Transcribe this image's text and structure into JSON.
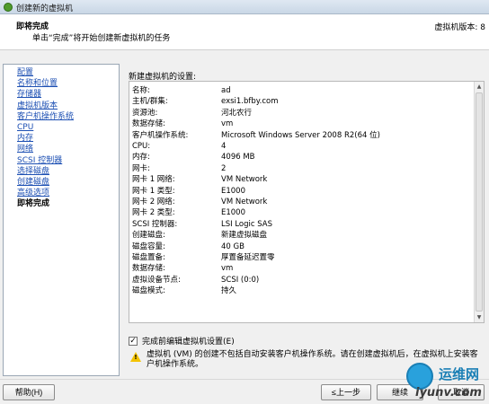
{
  "window": {
    "title": "创建新的虚拟机"
  },
  "header": {
    "title": "即将完成",
    "subtitle": "单击“完成”将开始创建新虚拟机的任务",
    "version": "虚拟机版本: 8"
  },
  "nav": {
    "items": [
      {
        "label": "配置"
      },
      {
        "label": "名称和位置"
      },
      {
        "label": "存储器"
      },
      {
        "label": "虚拟机版本"
      },
      {
        "label": "客户机操作系统"
      },
      {
        "label": "CPU"
      },
      {
        "label": "内存"
      },
      {
        "label": "网络"
      },
      {
        "label": "SCSI 控制器"
      },
      {
        "label": "选择磁盘"
      },
      {
        "label": "创建磁盘"
      },
      {
        "label": "高级选项"
      },
      {
        "label": "即将完成",
        "active": true
      }
    ]
  },
  "summary": {
    "label": "新建虚拟机的设置:",
    "rows": [
      {
        "key": "名称:",
        "value": "ad"
      },
      {
        "key": "主机/群集:",
        "value": "exsi1.bfby.com"
      },
      {
        "key": "资源池:",
        "value": "河北农行"
      },
      {
        "key": "数据存储:",
        "value": "vm"
      },
      {
        "key": "客户机操作系统:",
        "value": "Microsoft Windows Server 2008 R2(64 位)"
      },
      {
        "key": "CPU:",
        "value": "4"
      },
      {
        "key": "内存:",
        "value": "4096 MB"
      },
      {
        "key": "网卡:",
        "value": "2"
      },
      {
        "key": "网卡 1 网络:",
        "value": "VM Network"
      },
      {
        "key": "网卡 1 类型:",
        "value": "E1000"
      },
      {
        "key": "网卡 2 网络:",
        "value": "VM Network"
      },
      {
        "key": "网卡 2 类型:",
        "value": "E1000"
      },
      {
        "key": "SCSI 控制器:",
        "value": "LSI Logic SAS"
      },
      {
        "key": "创建磁盘:",
        "value": "新建虚拟磁盘"
      },
      {
        "key": "磁盘容量:",
        "value": "40 GB"
      },
      {
        "key": "磁盘置备:",
        "value": "厚置备延迟置零"
      },
      {
        "key": "数据存储:",
        "value": "vm"
      },
      {
        "key": "虚拟设备节点:",
        "value": "SCSI (0:0)"
      },
      {
        "key": "磁盘模式:",
        "value": "持久"
      }
    ]
  },
  "edit_settings": {
    "label": "完成前编辑虚拟机设置(E)",
    "checked": true,
    "check_glyph": "✓"
  },
  "warning": {
    "icon": "warning-icon",
    "mark": "!",
    "text": "虚拟机 (VM) 的创建不包括自动安装客户机操作系统。请在创建虚拟机后，在虚拟机上安装客户机操作系统。"
  },
  "footer": {
    "help": "帮助(H)",
    "back": "≤上一步",
    "finish": "继续",
    "cancel": "取消"
  },
  "watermark": {
    "name": "运维网",
    "url": "iyunv.com"
  },
  "scrollbar": {
    "up": "▲",
    "down": "▼"
  },
  "colors": {
    "link": "#1c4fb3",
    "warning": "#f3c300",
    "watermark": "#29a1dc"
  }
}
